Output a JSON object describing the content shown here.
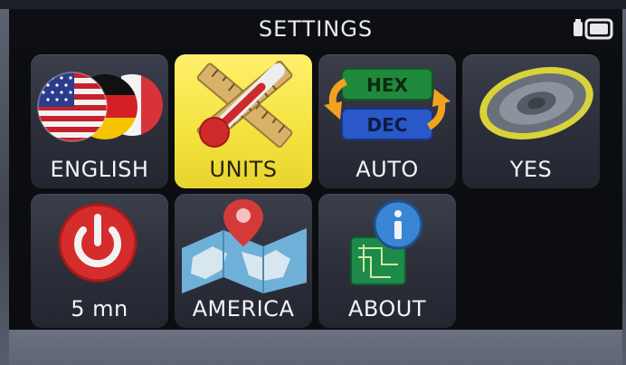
{
  "header": {
    "title": "SETTINGS"
  },
  "status": {
    "battery_icon": "battery-icon",
    "sd_icon": "sd-card-icon"
  },
  "tiles": [
    {
      "label": "ENGLISH",
      "icon": "language-flags-icon",
      "selected": false
    },
    {
      "label": "UNITS",
      "icon": "units-thermometer-ruler-icon",
      "selected": true
    },
    {
      "label": "AUTO",
      "icon": "hex-dec-toggle-icon",
      "selected": false
    },
    {
      "label": "YES",
      "icon": "speaker-icon",
      "selected": false
    },
    {
      "label": "5 mn",
      "icon": "power-icon",
      "selected": false
    },
    {
      "label": "AMERICA",
      "icon": "map-pin-icon",
      "selected": false
    },
    {
      "label": "ABOUT",
      "icon": "info-icon",
      "selected": false
    }
  ],
  "hex_dec": {
    "top": "HEX",
    "bottom": "DEC"
  },
  "colors": {
    "selected_tile": "#f3e23d",
    "titlebar": "#0e0f14",
    "tile": "#2c2f39"
  }
}
